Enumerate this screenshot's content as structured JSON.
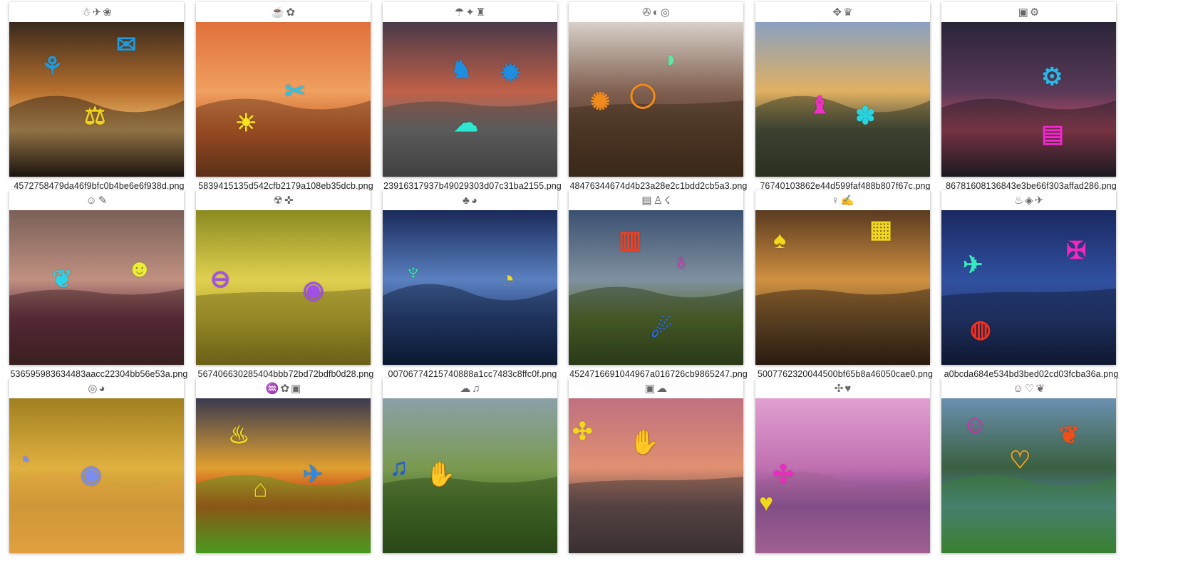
{
  "tiles": [
    {
      "filename": "4572758479da46f9bfc0b4be6e6f938d.png",
      "strip": [
        "☃",
        "✈",
        "❀"
      ],
      "bg": [
        "#3a2a1c",
        "#b8702e",
        "#f0c070",
        "#1c1410"
      ],
      "stickers": [
        {
          "glyph": "⚘",
          "color": "#1e9be0"
        },
        {
          "glyph": "✉",
          "color": "#1e9be0"
        },
        {
          "glyph": "⚖",
          "color": "#f2d21a"
        }
      ]
    },
    {
      "filename": "5839415135d542cfb2179a108eb35dcb.png",
      "strip": [
        "☕",
        "✿"
      ],
      "bg": [
        "#e0703a",
        "#f0a060",
        "#c8602a",
        "#5a3018"
      ],
      "stickers": [
        {
          "glyph": "✂",
          "color": "#29c4e8"
        },
        {
          "glyph": "☀",
          "color": "#f7e31c"
        }
      ]
    },
    {
      "filename": "23916317937b49029303d07c31ba2155.png",
      "strip": [
        "☂",
        "✦",
        "♜"
      ],
      "bg": [
        "#4a3a4a",
        "#c06048",
        "#707070",
        "#404040"
      ],
      "stickers": [
        {
          "glyph": "♞",
          "color": "#1e8fe0"
        },
        {
          "glyph": "✹",
          "color": "#1e8fe0"
        },
        {
          "glyph": "☁",
          "color": "#2de8d0"
        }
      ]
    },
    {
      "filename": "48476344674d4b23a28e2c1bdd2cb5a3.png",
      "strip": [
        "✇",
        "◐",
        "◎"
      ],
      "bg": [
        "#d8d0c8",
        "#806050",
        "#5a4030",
        "#3a2818"
      ],
      "stickers": [
        {
          "glyph": "◑",
          "color": "#5ee6a8"
        },
        {
          "glyph": "✺",
          "color": "#f08a1c"
        },
        {
          "glyph": "◯",
          "color": "#f08a1c"
        }
      ]
    },
    {
      "filename": "76740103862e44d599faf488b807f67c.png",
      "strip": [
        "✥",
        "♛"
      ],
      "bg": [
        "#8aa0c0",
        "#e0b060",
        "#4a5040",
        "#2a3020"
      ],
      "stickers": [
        {
          "glyph": "♝",
          "color": "#f02ec8"
        },
        {
          "glyph": "✽",
          "color": "#28d4e0"
        }
      ]
    },
    {
      "filename": "86781608136843e3be66f303affad286.png",
      "strip": [
        "▣",
        "⚙"
      ],
      "bg": [
        "#2a2438",
        "#5a3a58",
        "#c04a60",
        "#1a1820"
      ],
      "stickers": [
        {
          "glyph": "⚙",
          "color": "#2ab8e8"
        },
        {
          "glyph": "▤",
          "color": "#f028d0"
        }
      ]
    },
    {
      "filename": "536595983634483aacc22304bb56e53a.png",
      "strip": [
        "☺",
        "✎"
      ],
      "bg": [
        "#7a6058",
        "#c09080",
        "#6a3048",
        "#3a2020"
      ],
      "stickers": [
        {
          "glyph": "❦",
          "color": "#2ad4e8"
        },
        {
          "glyph": "☻",
          "color": "#e8ee30"
        }
      ]
    },
    {
      "filename": "567406630285404bbb72bd72bdfb0d28.png",
      "strip": [
        "☢",
        "✜"
      ],
      "bg": [
        "#8a8a20",
        "#e0d050",
        "#b8a830",
        "#6a6018"
      ],
      "stickers": [
        {
          "glyph": "⊖",
          "color": "#a050e8"
        },
        {
          "glyph": "◉",
          "color": "#a050e8"
        }
      ]
    },
    {
      "filename": "00706774215740888a1cc7483c8ffc0f.png",
      "strip": [
        "♣",
        "◕"
      ],
      "bg": [
        "#1a2a5a",
        "#5a80c0",
        "#304a80",
        "#0a1830"
      ],
      "stickers": [
        {
          "glyph": "♆",
          "color": "#38e8a8"
        },
        {
          "glyph": "◔",
          "color": "#f2d828"
        }
      ]
    },
    {
      "filename": "4524716691044967a016726cb9865247.png",
      "strip": [
        "▤",
        "♙",
        "☇"
      ],
      "bg": [
        "#3a5070",
        "#8090a0",
        "#5a7030",
        "#2a3a18"
      ],
      "stickers": [
        {
          "glyph": "▥",
          "color": "#f04020"
        },
        {
          "glyph": "♁",
          "color": "#f028c0"
        },
        {
          "glyph": "☄",
          "color": "#2868e8"
        }
      ]
    },
    {
      "filename": "5007762320044500bf65b8a46050cae0.png",
      "strip": [
        "♀",
        "✍"
      ],
      "bg": [
        "#5a3a20",
        "#d09040",
        "#806030",
        "#2a1a10"
      ],
      "stickers": [
        {
          "glyph": "♠",
          "color": "#f2d81c"
        },
        {
          "glyph": "▦",
          "color": "#f2d81c"
        }
      ]
    },
    {
      "filename": "a0bcda684e534bd3bed02cd03fcba36a.png",
      "strip": [
        "♨",
        "◈",
        "✈"
      ],
      "bg": [
        "#1a2860",
        "#3050a0",
        "#2a4080",
        "#101830"
      ],
      "stickers": [
        {
          "glyph": "✠",
          "color": "#f028c0"
        },
        {
          "glyph": "✈",
          "color": "#38e8c0"
        },
        {
          "glyph": "◍",
          "color": "#f03020"
        }
      ]
    },
    {
      "filename": "",
      "strip": [
        "◎",
        "◕"
      ],
      "bg": [
        "#a08020",
        "#e0b040",
        "#c09030",
        "#e0a040"
      ],
      "stickers": [
        {
          "glyph": "◔",
          "color": "#7a8ef0"
        },
        {
          "glyph": "◉",
          "color": "#7a8ef0"
        }
      ]
    },
    {
      "filename": "",
      "strip": [
        "♒",
        "✿",
        "▣"
      ],
      "bg": [
        "#3a3a50",
        "#e0a030",
        "#c02010",
        "#4a9a20"
      ],
      "stickers": [
        {
          "glyph": "♨",
          "color": "#f2d81c"
        },
        {
          "glyph": "⌂",
          "color": "#f2d81c"
        },
        {
          "glyph": "✈",
          "color": "#2a8ae8"
        }
      ]
    },
    {
      "filename": "",
      "strip": [
        "☁",
        "♫"
      ],
      "bg": [
        "#8aa0a8",
        "#7a9a50",
        "#4a7028",
        "#2a4818"
      ],
      "stickers": [
        {
          "glyph": "♫",
          "color": "#1e5ae8"
        },
        {
          "glyph": "✋",
          "color": "#f05018"
        }
      ]
    },
    {
      "filename": "",
      "strip": [
        "▣",
        "☁"
      ],
      "bg": [
        "#c07080",
        "#e09070",
        "#6a5050",
        "#3a3030"
      ],
      "stickers": [
        {
          "glyph": "✣",
          "color": "#f2d81c"
        },
        {
          "glyph": "✋",
          "color": "#48e890"
        }
      ]
    },
    {
      "filename": "",
      "strip": [
        "✣",
        "♥"
      ],
      "bg": [
        "#e0a0d0",
        "#c070b0",
        "#6a4080",
        "#a06090"
      ],
      "stickers": [
        {
          "glyph": "✣",
          "color": "#f028c0"
        },
        {
          "glyph": "♥",
          "color": "#f2d81c"
        }
      ]
    },
    {
      "filename": "",
      "strip": [
        "☺",
        "♡",
        "❦"
      ],
      "bg": [
        "#6a90b0",
        "#3a6040",
        "#5080a0",
        "#3a8030"
      ],
      "stickers": [
        {
          "glyph": "☺",
          "color": "#f028c0"
        },
        {
          "glyph": "❦",
          "color": "#f05018"
        },
        {
          "glyph": "♡",
          "color": "#f0a020"
        }
      ]
    }
  ]
}
